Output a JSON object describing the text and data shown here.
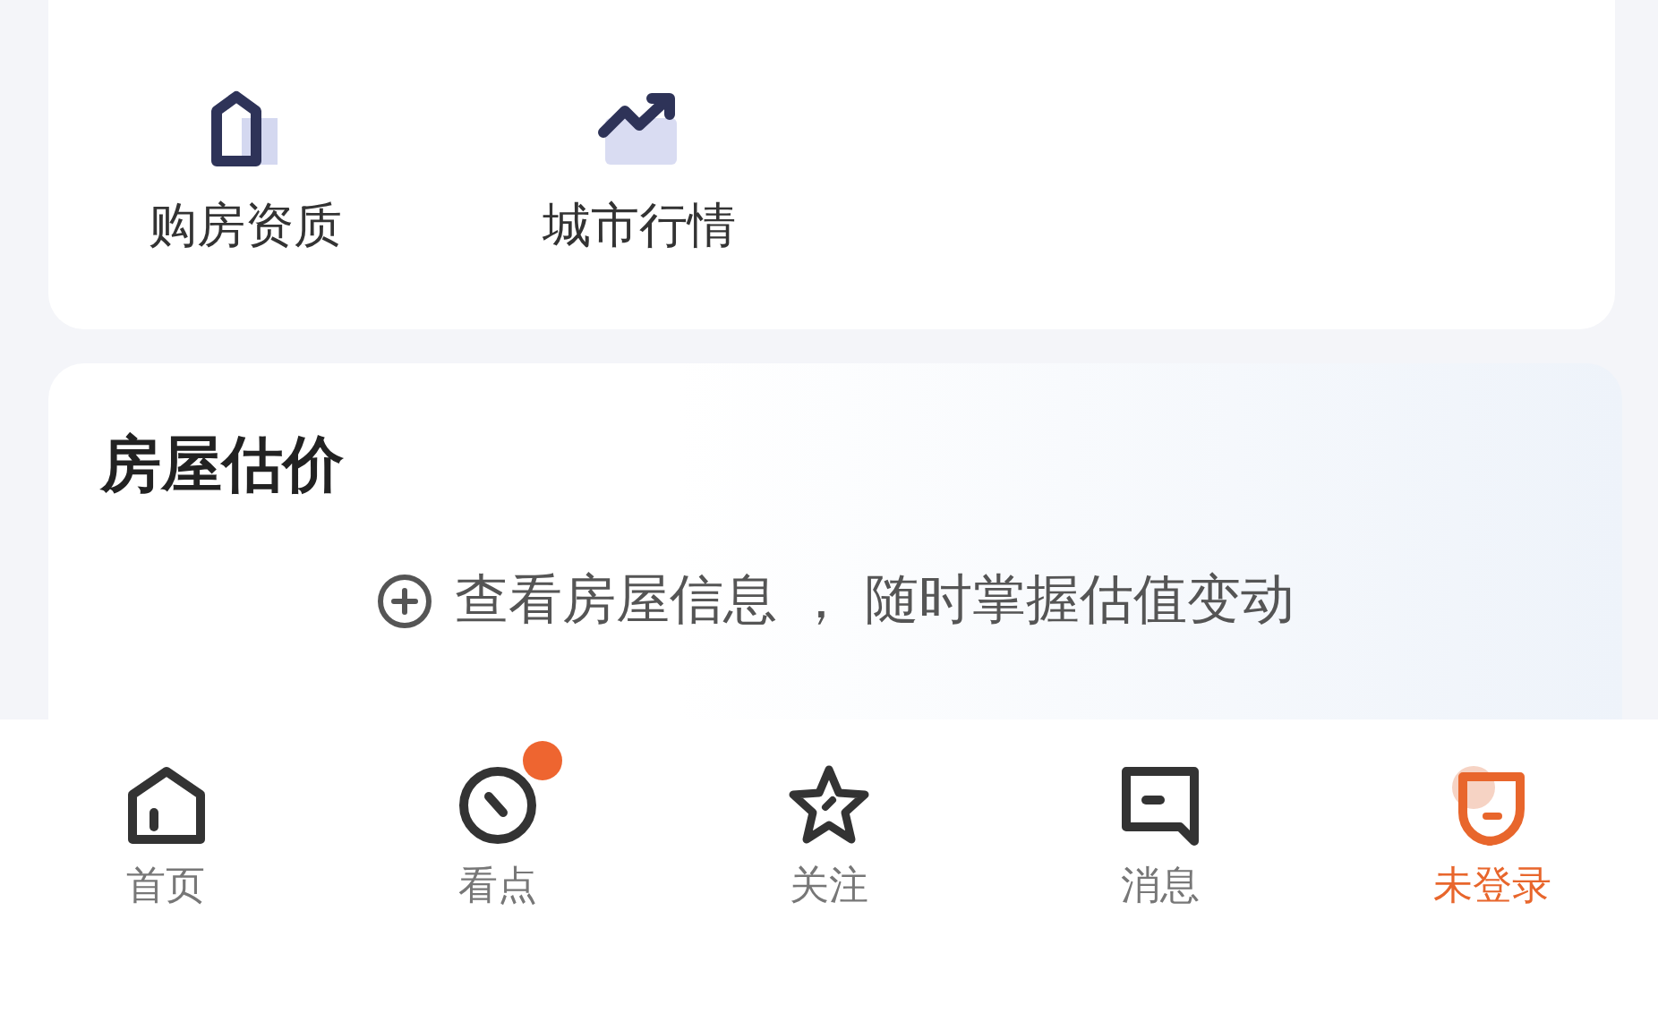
{
  "tools": [
    {
      "label": "购房资质",
      "kind": "qualification"
    },
    {
      "label": "城市行情",
      "kind": "trend"
    }
  ],
  "valuation": {
    "title": "房屋估价",
    "hint": "查看房屋信息 ， 随时掌握估值变动"
  },
  "nav": [
    {
      "label": "首页",
      "kind": "home",
      "selected": false,
      "badge": false
    },
    {
      "label": "看点",
      "kind": "discover",
      "selected": false,
      "badge": true
    },
    {
      "label": "关注",
      "kind": "follow",
      "selected": false,
      "badge": false
    },
    {
      "label": "消息",
      "kind": "message",
      "selected": false,
      "badge": false
    },
    {
      "label": "未登录",
      "kind": "profile",
      "selected": true,
      "badge": false
    }
  ]
}
